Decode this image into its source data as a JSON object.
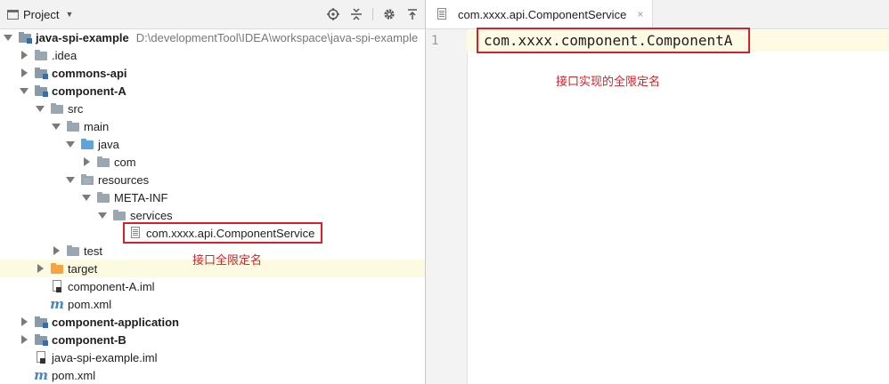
{
  "project_panel": {
    "title": "Project",
    "tools": [
      "locate-icon",
      "collapse-icon",
      "gear-icon",
      "hide-icon"
    ],
    "tree": [
      {
        "label": "java-spi-example",
        "path": "D:\\developmentTool\\IDEA\\workspace\\java-spi-example",
        "bold": true
      },
      {
        "label": ".idea"
      },
      {
        "label": "commons-api",
        "bold": true
      },
      {
        "label": "component-A",
        "bold": true
      },
      {
        "label": "src"
      },
      {
        "label": "main"
      },
      {
        "label": "java"
      },
      {
        "label": "com"
      },
      {
        "label": "resources"
      },
      {
        "label": "META-INF"
      },
      {
        "label": "services"
      },
      {
        "label": "com.xxxx.api.ComponentService"
      },
      {
        "label": "test"
      },
      {
        "label": "target"
      },
      {
        "label": "component-A.iml"
      },
      {
        "label": "pom.xml"
      },
      {
        "label": "component-application",
        "bold": true
      },
      {
        "label": "component-B",
        "bold": true
      },
      {
        "label": "java-spi-example.iml"
      },
      {
        "label": "pom.xml"
      }
    ],
    "annotation": "接口全限定名"
  },
  "editor": {
    "tab_label": "com.xxxx.api.ComponentService",
    "tab_close": "×",
    "line_number": "1",
    "code": "com.xxxx.component.ComponentA",
    "annotation": "接口实现的全限定名"
  },
  "colors": {
    "annotation_red": "#d6202a",
    "highlight_row": "#fcfae0",
    "caret_line": "#fffae3"
  }
}
